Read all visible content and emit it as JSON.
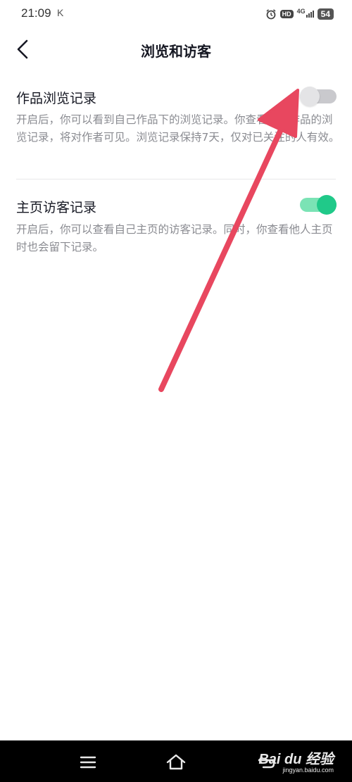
{
  "status_bar": {
    "time": "21:09",
    "carrier_mark": "K",
    "network": "4G",
    "hd_badge": "HD",
    "battery": "54",
    "icons": [
      "alarm-icon",
      "hd-icon",
      "signal-icon",
      "battery-icon"
    ]
  },
  "header": {
    "title": "浏览和访客",
    "back_icon": "chevron-left-icon"
  },
  "settings": [
    {
      "title": "作品浏览记录",
      "description": "开启后，你可以看到自己作品下的浏览记录。你查看他人作品的浏览记录，将对作者可见。浏览记录保持7天，仅对已关注的人有效。",
      "enabled": false
    },
    {
      "title": "主页访客记录",
      "description": "开启后，你可以查看自己主页的访客记录。同时，你查看他人主页时也会留下记录。",
      "enabled": true
    }
  ],
  "colors": {
    "toggle_on_track": "#7be3b5",
    "toggle_on_knob": "#20c989",
    "toggle_off_track": "#c9c9cd",
    "annotation_arrow": "#e8475f"
  },
  "nav_bar": {
    "buttons": [
      "menu-icon",
      "home-icon",
      "back-icon"
    ],
    "watermark": "Bai du 经验",
    "watermark_url": "jingyan.baidu.com"
  }
}
